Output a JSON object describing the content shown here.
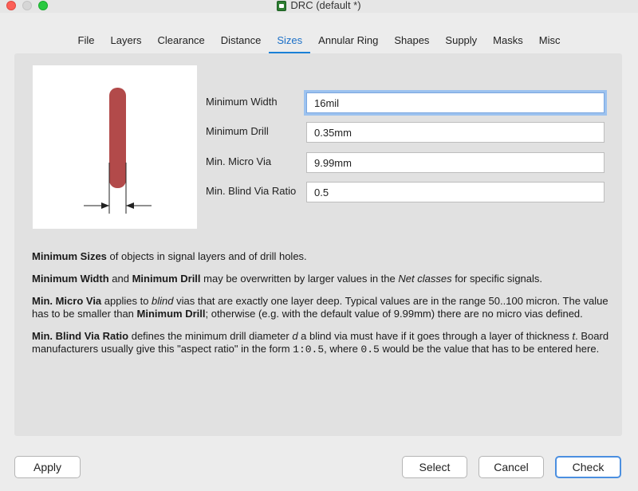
{
  "window": {
    "title": "DRC (default *)"
  },
  "tabs": [
    {
      "label": "File"
    },
    {
      "label": "Layers"
    },
    {
      "label": "Clearance"
    },
    {
      "label": "Distance"
    },
    {
      "label": "Sizes"
    },
    {
      "label": "Annular Ring"
    },
    {
      "label": "Shapes"
    },
    {
      "label": "Supply"
    },
    {
      "label": "Masks"
    },
    {
      "label": "Misc"
    }
  ],
  "active_tab": "Sizes",
  "fields": {
    "min_width": {
      "label": "Minimum Width",
      "value": "16mil"
    },
    "min_drill": {
      "label": "Minimum Drill",
      "value": "0.35mm"
    },
    "min_micro_via": {
      "label": "Min. Micro Via",
      "value": "9.99mm"
    },
    "min_blind_via_ratio": {
      "label": "Min. Blind Via Ratio",
      "value": "0.5"
    }
  },
  "description": {
    "p1": {
      "b1": "Minimum Sizes",
      "t1": " of objects in signal layers and of drill holes."
    },
    "p2": {
      "b1": "Minimum Width",
      "t1": " and ",
      "b2": "Minimum Drill",
      "t2": " may be overwritten by larger values in the ",
      "i1": "Net classes",
      "t3": " for specific signals."
    },
    "p3": {
      "b1": "Min. Micro Via",
      "t1": " applies to ",
      "i1": "blind",
      "t2": " vias that are exactly one layer deep. Typical values are in the range 50..100 micron. The value has to be smaller than ",
      "b2": "Minimum Drill",
      "t3": "; otherwise (e.g. with the default value of 9.99mm) there are no micro vias defined."
    },
    "p4": {
      "b1": "Min. Blind Via Ratio",
      "t1": " defines the minimum drill diameter ",
      "i1": "d",
      "t2": " a blind via must have if it goes through a layer of thickness ",
      "i2": "t",
      "t3": ". Board manufacturers usually give this \"aspect ratio\" in the form ",
      "m1": "1:0.5",
      "t4": ", where ",
      "m2": "0.5",
      "t5": " would be the value that has to be entered here."
    }
  },
  "buttons": {
    "apply": "Apply",
    "select": "Select",
    "cancel": "Cancel",
    "check": "Check"
  },
  "colors": {
    "accent": "#1a80d6",
    "trace": "#b24a4a",
    "focus_ring": "#9cc2ef"
  }
}
